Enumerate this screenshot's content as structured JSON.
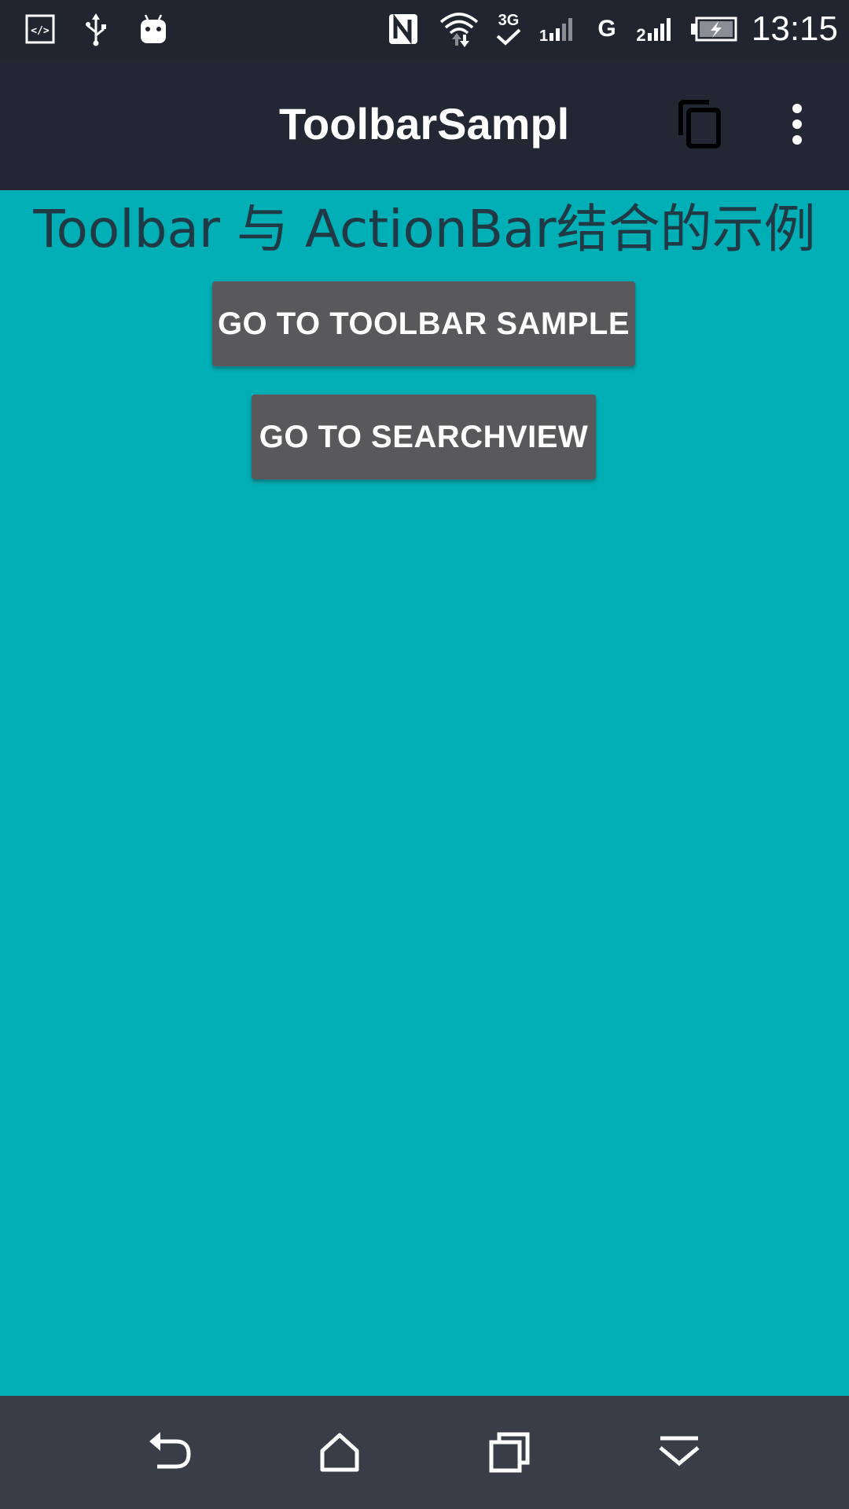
{
  "status_bar": {
    "time": "13:15",
    "network_3g_label": "3G",
    "network_g_label": "G",
    "signal_2_label": "2",
    "signal_1_label": "1",
    "icons": [
      "code-icon",
      "usb-icon",
      "android-icon",
      "nfc-icon",
      "wifi-icon",
      "3g-icon",
      "signal-icon",
      "g-network-icon",
      "signal-icon",
      "battery-charging-icon"
    ]
  },
  "toolbar": {
    "title": "ToolbarSampl",
    "actions": [
      "copy-icon",
      "overflow-menu-icon"
    ],
    "background": "#222733"
  },
  "main": {
    "heading": "Toolbar 与 ActionBar结合的示例",
    "buttons": [
      {
        "label": "GO TO TOOLBAR SAMPLE"
      },
      {
        "label": "GO TO SEARCHVIEW"
      }
    ],
    "background": "#00aeb5",
    "button_color": "#59595c"
  },
  "nav_bar": {
    "icons": [
      "back-icon",
      "home-icon",
      "recent-apps-icon",
      "hide-nav-icon"
    ]
  }
}
